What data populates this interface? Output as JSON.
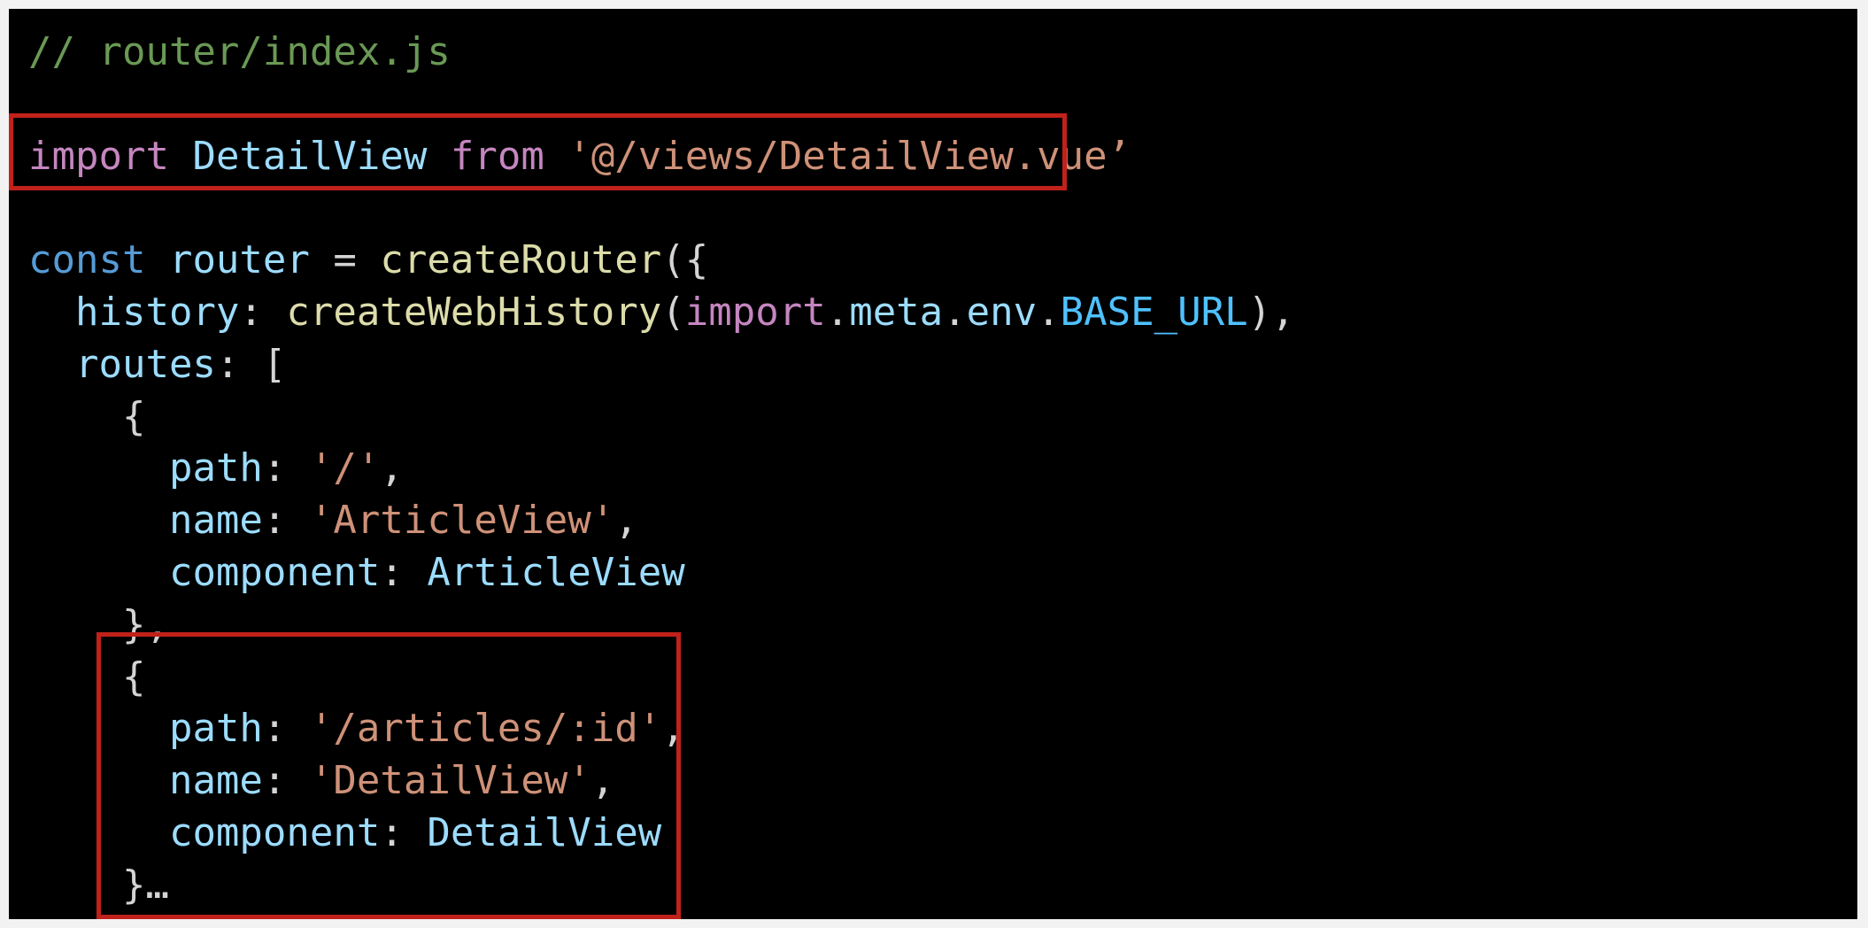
{
  "colors": {
    "background": "#000000",
    "comment": "#6a9955",
    "keyword_purple": "#c586c0",
    "keyword_blue": "#569cd6",
    "identifier": "#9cdcfe",
    "string": "#ce9178",
    "function": "#dcdcaa",
    "constant": "#4fc1ff",
    "punctuation": "#d4d4d4",
    "highlight_border": "#c0211a"
  },
  "code_lines": [
    [
      {
        "t": "// router/index.js",
        "c": "comment"
      }
    ],
    [],
    [
      {
        "t": "import",
        "c": "keyword_purple"
      },
      {
        "t": " ",
        "c": "punctuation"
      },
      {
        "t": "DetailView",
        "c": "identifier"
      },
      {
        "t": " ",
        "c": "punctuation"
      },
      {
        "t": "from",
        "c": "keyword_purple"
      },
      {
        "t": " ",
        "c": "punctuation"
      },
      {
        "t": "'@/views/DetailView.vue’",
        "c": "string"
      }
    ],
    [],
    [
      {
        "t": "const",
        "c": "keyword_blue"
      },
      {
        "t": " ",
        "c": "punctuation"
      },
      {
        "t": "router",
        "c": "identifier"
      },
      {
        "t": " = ",
        "c": "punctuation"
      },
      {
        "t": "createRouter",
        "c": "function"
      },
      {
        "t": "({",
        "c": "punctuation"
      }
    ],
    [
      {
        "t": "  ",
        "c": "punctuation"
      },
      {
        "t": "history",
        "c": "identifier"
      },
      {
        "t": ": ",
        "c": "punctuation"
      },
      {
        "t": "createWebHistory",
        "c": "function"
      },
      {
        "t": "(",
        "c": "punctuation"
      },
      {
        "t": "import",
        "c": "keyword_purple"
      },
      {
        "t": ".",
        "c": "punctuation"
      },
      {
        "t": "meta",
        "c": "identifier"
      },
      {
        "t": ".",
        "c": "punctuation"
      },
      {
        "t": "env",
        "c": "identifier"
      },
      {
        "t": ".",
        "c": "punctuation"
      },
      {
        "t": "BASE_URL",
        "c": "constant"
      },
      {
        "t": "),",
        "c": "punctuation"
      }
    ],
    [
      {
        "t": "  ",
        "c": "punctuation"
      },
      {
        "t": "routes",
        "c": "identifier"
      },
      {
        "t": ": [",
        "c": "punctuation"
      }
    ],
    [
      {
        "t": "    {",
        "c": "punctuation"
      }
    ],
    [
      {
        "t": "      ",
        "c": "punctuation"
      },
      {
        "t": "path",
        "c": "identifier"
      },
      {
        "t": ": ",
        "c": "punctuation"
      },
      {
        "t": "'/'",
        "c": "string"
      },
      {
        "t": ",",
        "c": "punctuation"
      }
    ],
    [
      {
        "t": "      ",
        "c": "punctuation"
      },
      {
        "t": "name",
        "c": "identifier"
      },
      {
        "t": ": ",
        "c": "punctuation"
      },
      {
        "t": "'ArticleView'",
        "c": "string"
      },
      {
        "t": ",",
        "c": "punctuation"
      }
    ],
    [
      {
        "t": "      ",
        "c": "punctuation"
      },
      {
        "t": "component",
        "c": "identifier"
      },
      {
        "t": ": ",
        "c": "punctuation"
      },
      {
        "t": "ArticleView",
        "c": "identifier"
      }
    ],
    [
      {
        "t": "    },",
        "c": "punctuation"
      }
    ],
    [
      {
        "t": "    {",
        "c": "punctuation"
      }
    ],
    [
      {
        "t": "      ",
        "c": "punctuation"
      },
      {
        "t": "path",
        "c": "identifier"
      },
      {
        "t": ": ",
        "c": "punctuation"
      },
      {
        "t": "'/articles/:id'",
        "c": "string"
      },
      {
        "t": ",",
        "c": "punctuation"
      }
    ],
    [
      {
        "t": "      ",
        "c": "punctuation"
      },
      {
        "t": "name",
        "c": "identifier"
      },
      {
        "t": ": ",
        "c": "punctuation"
      },
      {
        "t": "'DetailView'",
        "c": "string"
      },
      {
        "t": ",",
        "c": "punctuation"
      }
    ],
    [
      {
        "t": "      ",
        "c": "punctuation"
      },
      {
        "t": "component",
        "c": "identifier"
      },
      {
        "t": ": ",
        "c": "punctuation"
      },
      {
        "t": "DetailView",
        "c": "identifier"
      }
    ],
    [
      {
        "t": "    }…",
        "c": "punctuation"
      }
    ]
  ]
}
